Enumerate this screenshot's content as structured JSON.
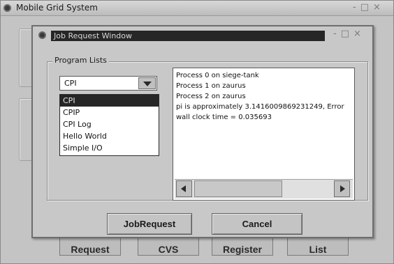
{
  "outer_window": {
    "title": "Mobile Grid System",
    "background_buttons": [
      "Request",
      "CVS",
      "Register",
      "List"
    ]
  },
  "dialog": {
    "title": "Job Request Window",
    "group_label": "Program Lists",
    "program_combo": {
      "selected": "CPI",
      "options": [
        {
          "label": "CPI",
          "selected": true
        },
        {
          "label": "CPIP",
          "selected": false
        },
        {
          "label": "CPI Log",
          "selected": false
        },
        {
          "label": "Hello World",
          "selected": false
        },
        {
          "label": "Simple I/O",
          "selected": false
        }
      ]
    },
    "output_lines": [
      "Process 0 on siege-tank",
      "Process 1 on zaurus",
      "Process 2 on zaurus",
      "pi is approximately 3.1416009869231249, Error",
      "wall clock time = 0.035693"
    ],
    "buttons": {
      "job_request": "JobRequest",
      "cancel": "Cancel"
    }
  },
  "colors": {
    "window_bg": "#c4c4c4",
    "title_strip": "#262626",
    "selection": "#262626"
  }
}
